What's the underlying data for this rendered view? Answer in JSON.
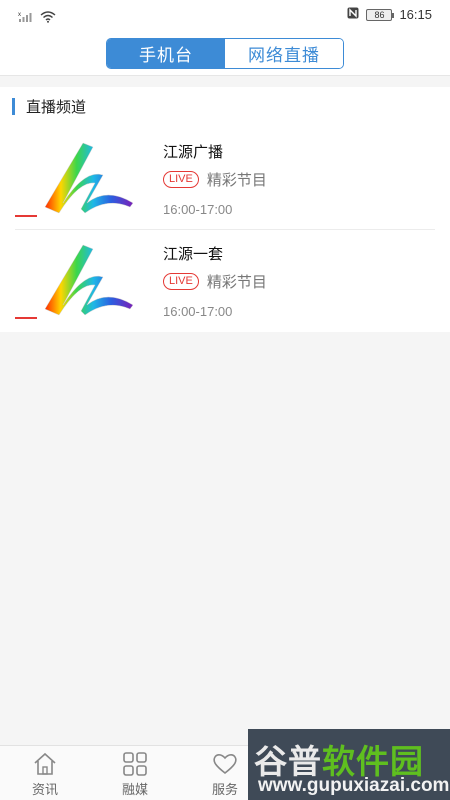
{
  "status_bar": {
    "battery": "86",
    "time": "16:15",
    "icons": [
      "signal-icon",
      "wifi-icon",
      "nfc-icon",
      "battery-icon"
    ]
  },
  "header": {
    "tabs": [
      {
        "label": "手机台",
        "active": true
      },
      {
        "label": "网络直播",
        "active": false
      }
    ]
  },
  "section": {
    "title": "直播频道"
  },
  "channels": [
    {
      "title": "江源广播",
      "badge": "LIVE",
      "program": "精彩节目",
      "time": "16:00-17:00"
    },
    {
      "title": "江源一套",
      "badge": "LIVE",
      "program": "精彩节目",
      "time": "16:00-17:00"
    }
  ],
  "bottom_nav": [
    {
      "label": "资讯",
      "icon": "home-icon"
    },
    {
      "label": "融媒",
      "icon": "grid-icon"
    },
    {
      "label": "服务",
      "icon": "heart-icon"
    }
  ],
  "watermark": {
    "title_part1": "谷普",
    "title_part2": "软件园",
    "url": "www.gupuxiazai.com"
  },
  "colors": {
    "accent": "#3d8bd6",
    "live": "#e53935",
    "watermark_bg": "#3f4a57"
  }
}
